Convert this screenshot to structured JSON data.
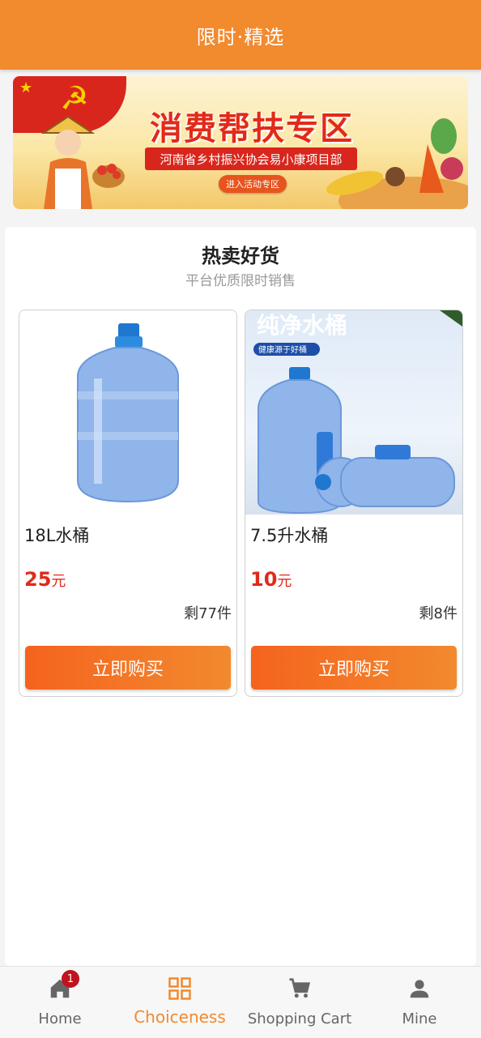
{
  "header": {
    "title": "限时·精选"
  },
  "banner": {
    "headline": "消费帮扶专区",
    "subtitle": "河南省乡村振兴协会易小康项目部",
    "button": "进入活动专区"
  },
  "section": {
    "title": "热卖好货",
    "subtitle": "平台优质限时销售"
  },
  "products": [
    {
      "name": "18L水桶",
      "price": "25",
      "unit": "元",
      "stock": "剩77件",
      "buy_label": "立即购买"
    },
    {
      "name": "7.5升水桶",
      "price": "10",
      "unit": "元",
      "stock": "剩8件",
      "buy_label": "立即购买",
      "image_text": "纯净水桶",
      "image_tag": "健康源于好桶"
    }
  ],
  "tabs": [
    {
      "label": "Home",
      "icon": "home-icon",
      "badge": "1"
    },
    {
      "label": "Choiceness",
      "icon": "grid-icon",
      "active": true
    },
    {
      "label": "Shopping Cart",
      "icon": "cart-icon"
    },
    {
      "label": "Mine",
      "icon": "person-icon"
    }
  ],
  "colors": {
    "accent": "#f28a2e",
    "price": "#e02a1a",
    "badge": "#c0121f"
  }
}
